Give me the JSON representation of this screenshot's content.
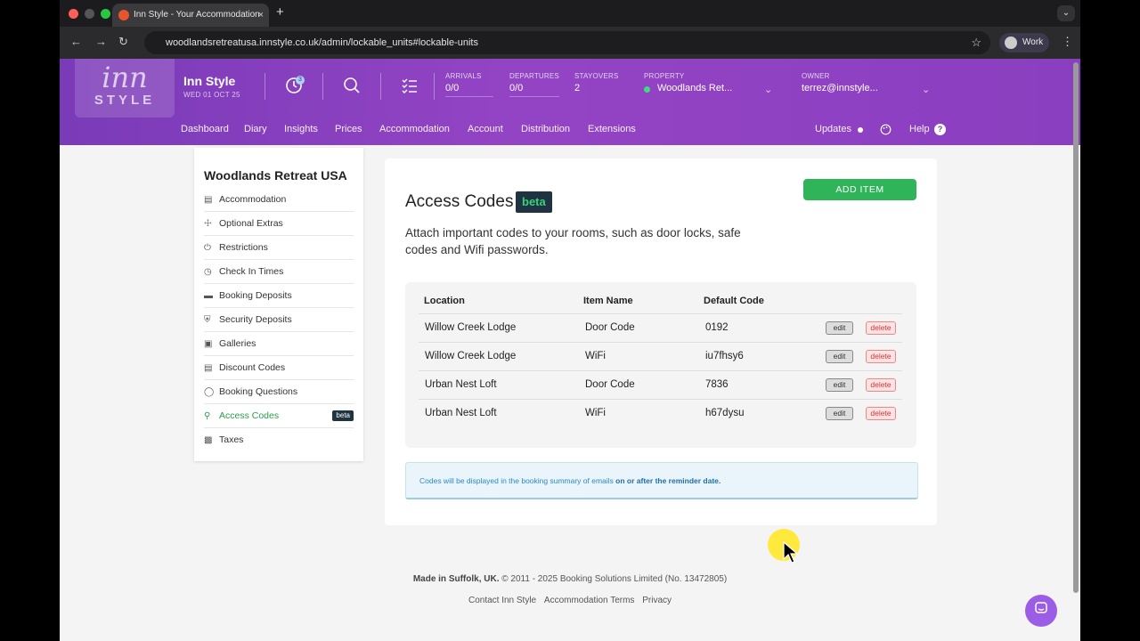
{
  "browser": {
    "tab_title": "Inn Style - Your Accommodation",
    "tab_close": "×",
    "new_tab": "+",
    "url": "woodlandsretreatusa.innstyle.co.uk/admin/lockable_units#lockable-units",
    "profile_name": "Work",
    "back": "←",
    "forward": "→",
    "reload": "↻",
    "star": "☆",
    "menu": "⋮",
    "tab_menu": "⌄"
  },
  "header": {
    "logo_top": "inn",
    "logo_bottom": "STYLE",
    "brand": "Inn Style",
    "date": "WED 01 OCT 25",
    "notification_count": "3",
    "arrivals_label": "ARRIVALS",
    "arrivals_value": "0/0",
    "departures_label": "DEPARTURES",
    "departures_value": "0/0",
    "stayovers_label": "STAYOVERS",
    "stayovers_value": "2",
    "property_label": "PROPERTY",
    "property_value": "Woodlands Ret...",
    "owner_label": "OWNER",
    "owner_value": "terrez@innstyle...",
    "nav": [
      "Dashboard",
      "Diary",
      "Insights",
      "Prices",
      "Accommodation",
      "Account",
      "Distribution",
      "Extensions"
    ],
    "updates": "Updates",
    "help": "Help",
    "help_q": "?",
    "brand_color": "#8a3fc0"
  },
  "sidebar": {
    "title": "Woodlands Retreat USA",
    "items": [
      {
        "label": "Accommodation",
        "icon": "bed-icon"
      },
      {
        "label": "Optional Extras",
        "icon": "cart-icon"
      },
      {
        "label": "Restrictions",
        "icon": "power-icon"
      },
      {
        "label": "Check In Times",
        "icon": "clock-icon"
      },
      {
        "label": "Booking Deposits",
        "icon": "card-icon"
      },
      {
        "label": "Security Deposits",
        "icon": "shield-icon"
      },
      {
        "label": "Galleries",
        "icon": "image-icon"
      },
      {
        "label": "Discount Codes",
        "icon": "tag-icon"
      },
      {
        "label": "Booking Questions",
        "icon": "chat-icon"
      },
      {
        "label": "Access Codes",
        "icon": "key-icon",
        "active": true,
        "badge": "beta"
      },
      {
        "label": "Taxes",
        "icon": "briefcase-icon"
      }
    ]
  },
  "main": {
    "title": "Access Codes",
    "beta": "beta",
    "add_button": "ADD ITEM",
    "description": "Attach important codes to your rooms, such as door locks, safe codes and Wifi passwords.",
    "columns": [
      "Location",
      "Item Name",
      "Default Code"
    ],
    "rows": [
      {
        "location": "Willow Creek Lodge",
        "item": "Door Code",
        "code": "0192"
      },
      {
        "location": "Willow Creek Lodge",
        "item": "WiFi",
        "code": "iu7fhsy6"
      },
      {
        "location": "Urban Nest Loft",
        "item": "Door Code",
        "code": "7836"
      },
      {
        "location": "Urban Nest Loft",
        "item": "WiFi",
        "code": "h67dysu"
      }
    ],
    "edit_label": "edit",
    "delete_label": "delete",
    "notice_text": "Codes will be displayed in the booking summary of emails ",
    "notice_bold": "on or after the reminder date."
  },
  "footer": {
    "made_in": "Made in Suffolk, UK.",
    "copyright": " © 2011 - 2025 Booking Solutions Limited (No. 13472805)",
    "links": [
      "Contact Inn Style",
      "Accommodation Terms",
      "Privacy"
    ]
  }
}
